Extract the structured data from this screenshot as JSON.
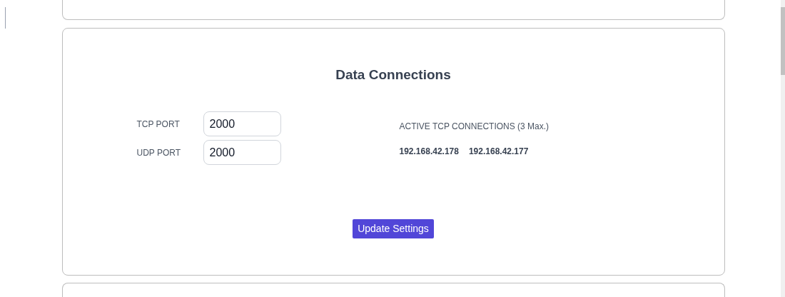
{
  "section": {
    "title": "Data Connections",
    "fields": [
      {
        "label": "TCP PORT",
        "value": "2000"
      },
      {
        "label": "UDP PORT",
        "value": "2000"
      }
    ],
    "connections": {
      "heading": "ACTIVE TCP CONNECTIONS (3 Max.)",
      "addresses": [
        "192.168.42.178",
        "192.168.42.177"
      ]
    },
    "button": "Update Settings"
  }
}
